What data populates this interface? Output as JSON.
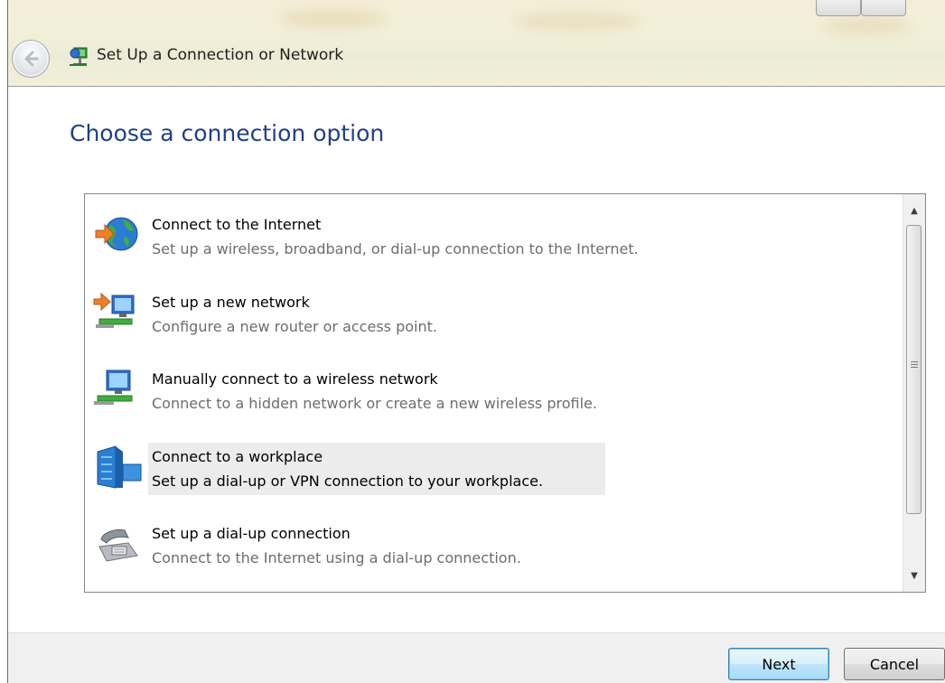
{
  "window": {
    "title": "Set Up a Connection or Network"
  },
  "page": {
    "heading": "Choose a connection option"
  },
  "options": [
    {
      "label": "Connect to the Internet",
      "description": "Set up a wireless, broadband, or dial-up connection to the Internet.",
      "icon": "internet-globe-icon"
    },
    {
      "label": "Set up a new network",
      "description": "Configure a new router or access point.",
      "icon": "new-network-icon"
    },
    {
      "label": "Manually connect to a wireless network",
      "description": "Connect to a hidden network or create a new wireless profile.",
      "icon": "wireless-network-icon"
    },
    {
      "label": "Connect to a workplace",
      "description": "Set up a dial-up or VPN connection to your workplace.",
      "icon": "workplace-icon",
      "selected": true
    },
    {
      "label": "Set up a dial-up connection",
      "description": "Connect to the Internet using a dial-up connection.",
      "icon": "dialup-phone-icon"
    }
  ],
  "buttons": {
    "next": "Next",
    "cancel": "Cancel"
  },
  "colors": {
    "heading": "#1f3f8a",
    "selection": "#ececec",
    "description": "#6d6d6d"
  }
}
